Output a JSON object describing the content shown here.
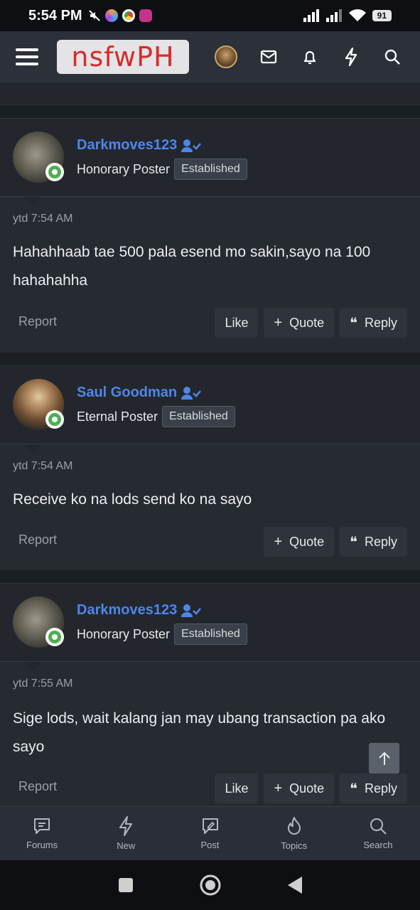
{
  "status_bar": {
    "time": "5:54 PM",
    "battery": "91"
  },
  "header": {
    "logo_text": "nsfwPH"
  },
  "posts": [
    {
      "username": "Darkmoves123",
      "rank": "Honorary Poster",
      "badge": "Established",
      "time": "ytd 7:54 AM",
      "body": "Hahahhaab tae 500 pala esend mo sakin,sayo na 100 hahahahha",
      "report": "Report",
      "like": "Like",
      "quote": "Quote",
      "reply": "Reply"
    },
    {
      "username": "Saul Goodman",
      "rank": "Eternal Poster",
      "badge": "Established",
      "time": "ytd 7:54 AM",
      "body": "Receive ko na lods send ko na sayo",
      "report": "Report",
      "quote": "Quote",
      "reply": "Reply"
    },
    {
      "username": "Darkmoves123",
      "rank": "Honorary Poster",
      "badge": "Established",
      "time": "ytd 7:55 AM",
      "body": "Sige lods, wait kalang jan may ubang transaction pa ako sayo",
      "report": "Report",
      "like": "Like",
      "quote": "Quote",
      "reply": "Reply"
    }
  ],
  "bottom_nav": [
    {
      "label": "Forums",
      "icon": "forums-icon"
    },
    {
      "label": "New",
      "icon": "bolt-icon"
    },
    {
      "label": "Post",
      "icon": "post-icon"
    },
    {
      "label": "Topics",
      "icon": "fire-icon"
    },
    {
      "label": "Search",
      "icon": "search-icon"
    }
  ],
  "colors": {
    "accent": "#4f86e8",
    "online": "#4caf50",
    "logo": "#d82b2b"
  }
}
